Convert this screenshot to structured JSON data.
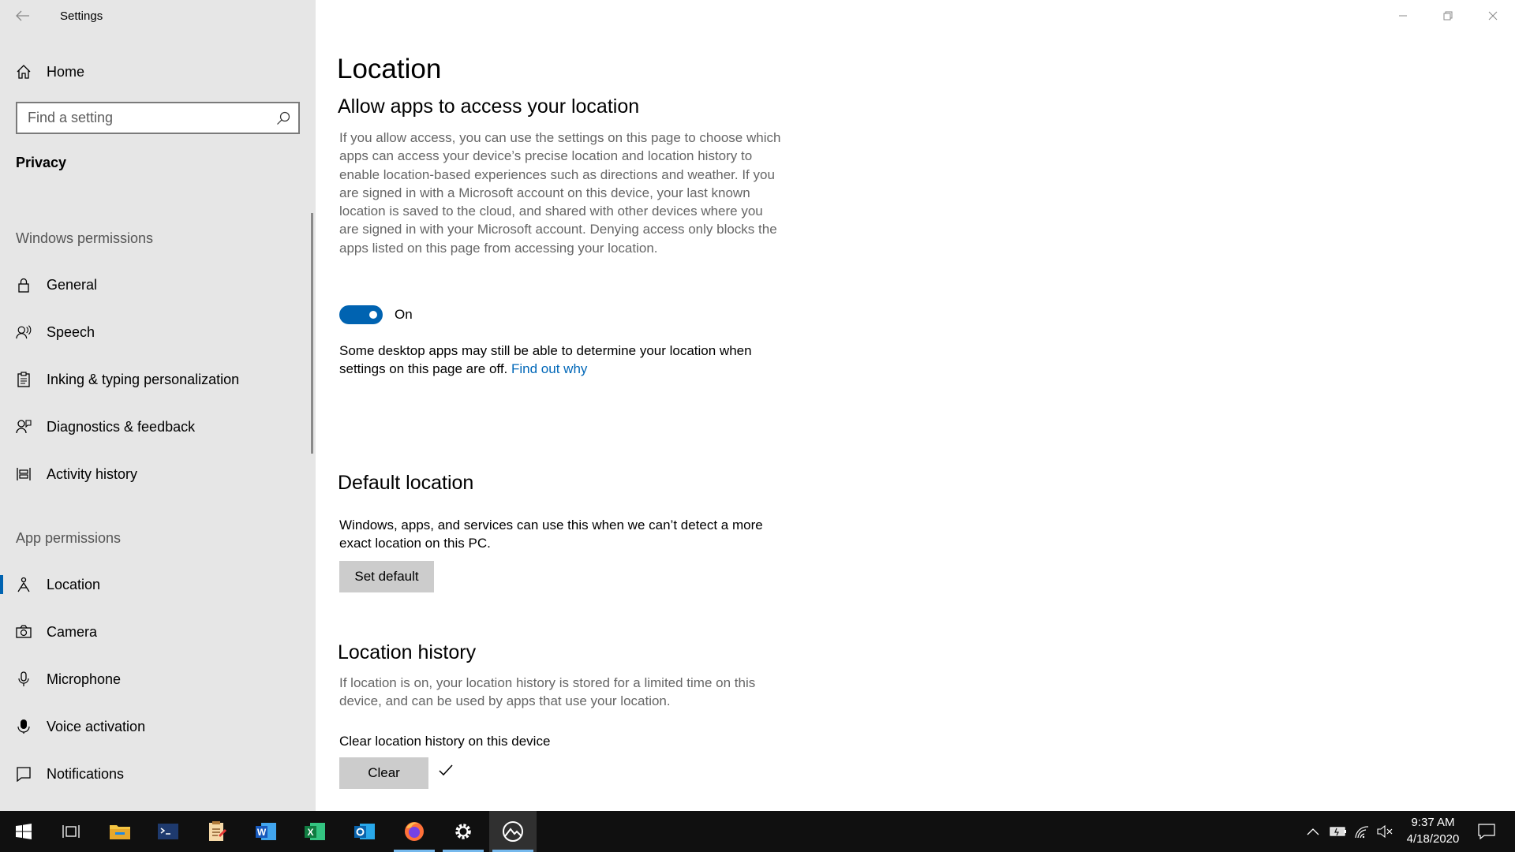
{
  "window": {
    "app_title": "Settings"
  },
  "sidebar": {
    "home_label": "Home",
    "search_placeholder": "Find a setting",
    "section_title": "Privacy",
    "groups": {
      "windows_permissions": "Windows permissions",
      "app_permissions": "App permissions"
    },
    "items": [
      {
        "label": "General",
        "icon": "lock-icon"
      },
      {
        "label": "Speech",
        "icon": "speech-icon"
      },
      {
        "label": "Inking & typing personalization",
        "icon": "clipboard-icon"
      },
      {
        "label": "Diagnostics & feedback",
        "icon": "feedback-icon"
      },
      {
        "label": "Activity history",
        "icon": "activity-history-icon"
      },
      {
        "label": "Location",
        "icon": "location-icon",
        "selected": true
      },
      {
        "label": "Camera",
        "icon": "camera-icon"
      },
      {
        "label": "Microphone",
        "icon": "microphone-icon"
      },
      {
        "label": "Voice activation",
        "icon": "voice-activation-icon"
      },
      {
        "label": "Notifications",
        "icon": "notifications-icon"
      }
    ]
  },
  "main": {
    "page_title": "Location",
    "allow_section": {
      "heading": "Allow apps to access your location",
      "description": "If you allow access, you can use the settings on this page to choose which apps can access your device’s precise location and location history to enable location-based experiences such as directions and weather. If you are signed in with a Microsoft account on this device, your last known location is saved to the cloud, and shared with other devices where you are signed in with your Microsoft account. Denying access only blocks the apps listed on this page from accessing your location.",
      "toggle_state": "On",
      "note": "Some desktop apps may still be able to determine your location when settings on this page are off.",
      "link": "Find out why"
    },
    "default_section": {
      "heading": "Default location",
      "description": "Windows, apps, and services can use this when we can’t detect a more exact location on this PC.",
      "button": "Set default"
    },
    "history_section": {
      "heading": "Location history",
      "description": "If location is on, your location history is stored for a limited time on this device, and can be used by apps that use your location.",
      "clear_label": "Clear location history on this device",
      "button": "Clear"
    }
  },
  "taskbar": {
    "time": "9:37 AM",
    "date": "4/18/2020",
    "apps": [
      "start-icon",
      "task-view-icon",
      "file-explorer-icon",
      "terminal-icon",
      "notepad-icon",
      "word-icon",
      "excel-icon",
      "outlook-icon",
      "firefox-icon",
      "settings-icon",
      "photos-icon"
    ]
  },
  "colors": {
    "accent": "#0063b1",
    "link": "#0067b8",
    "sidebar_bg": "#e6e6e6",
    "taskbar_bg": "#101010"
  }
}
